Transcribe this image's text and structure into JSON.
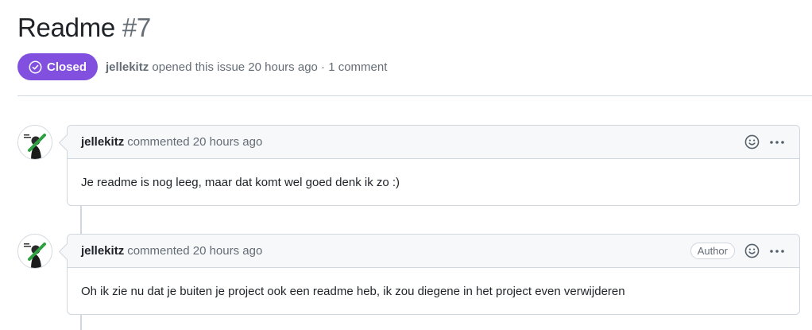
{
  "issue": {
    "title": "Readme",
    "number": "#7",
    "state": "Closed",
    "author": "jellekitz",
    "meta": "opened this issue 20 hours ago · 1 comment"
  },
  "comments": [
    {
      "author": "jellekitz",
      "action": "commented 20 hours ago",
      "body": "Je readme is nog leeg, maar dat komt wel goed denk ik zo :)",
      "author_label": ""
    },
    {
      "author": "jellekitz",
      "action": "commented 20 hours ago",
      "body": "Oh ik zie nu dat je buiten je project ook een readme heb, ik zou diegene in het project even verwijderen",
      "author_label": "Author"
    }
  ],
  "colors": {
    "closed_badge": "#8250df",
    "border": "#d0d7de",
    "muted_text": "#656d76"
  },
  "icons": {
    "state": "check-circle-icon",
    "reaction": "smiley-icon",
    "menu": "kebab-horizontal-icon"
  }
}
